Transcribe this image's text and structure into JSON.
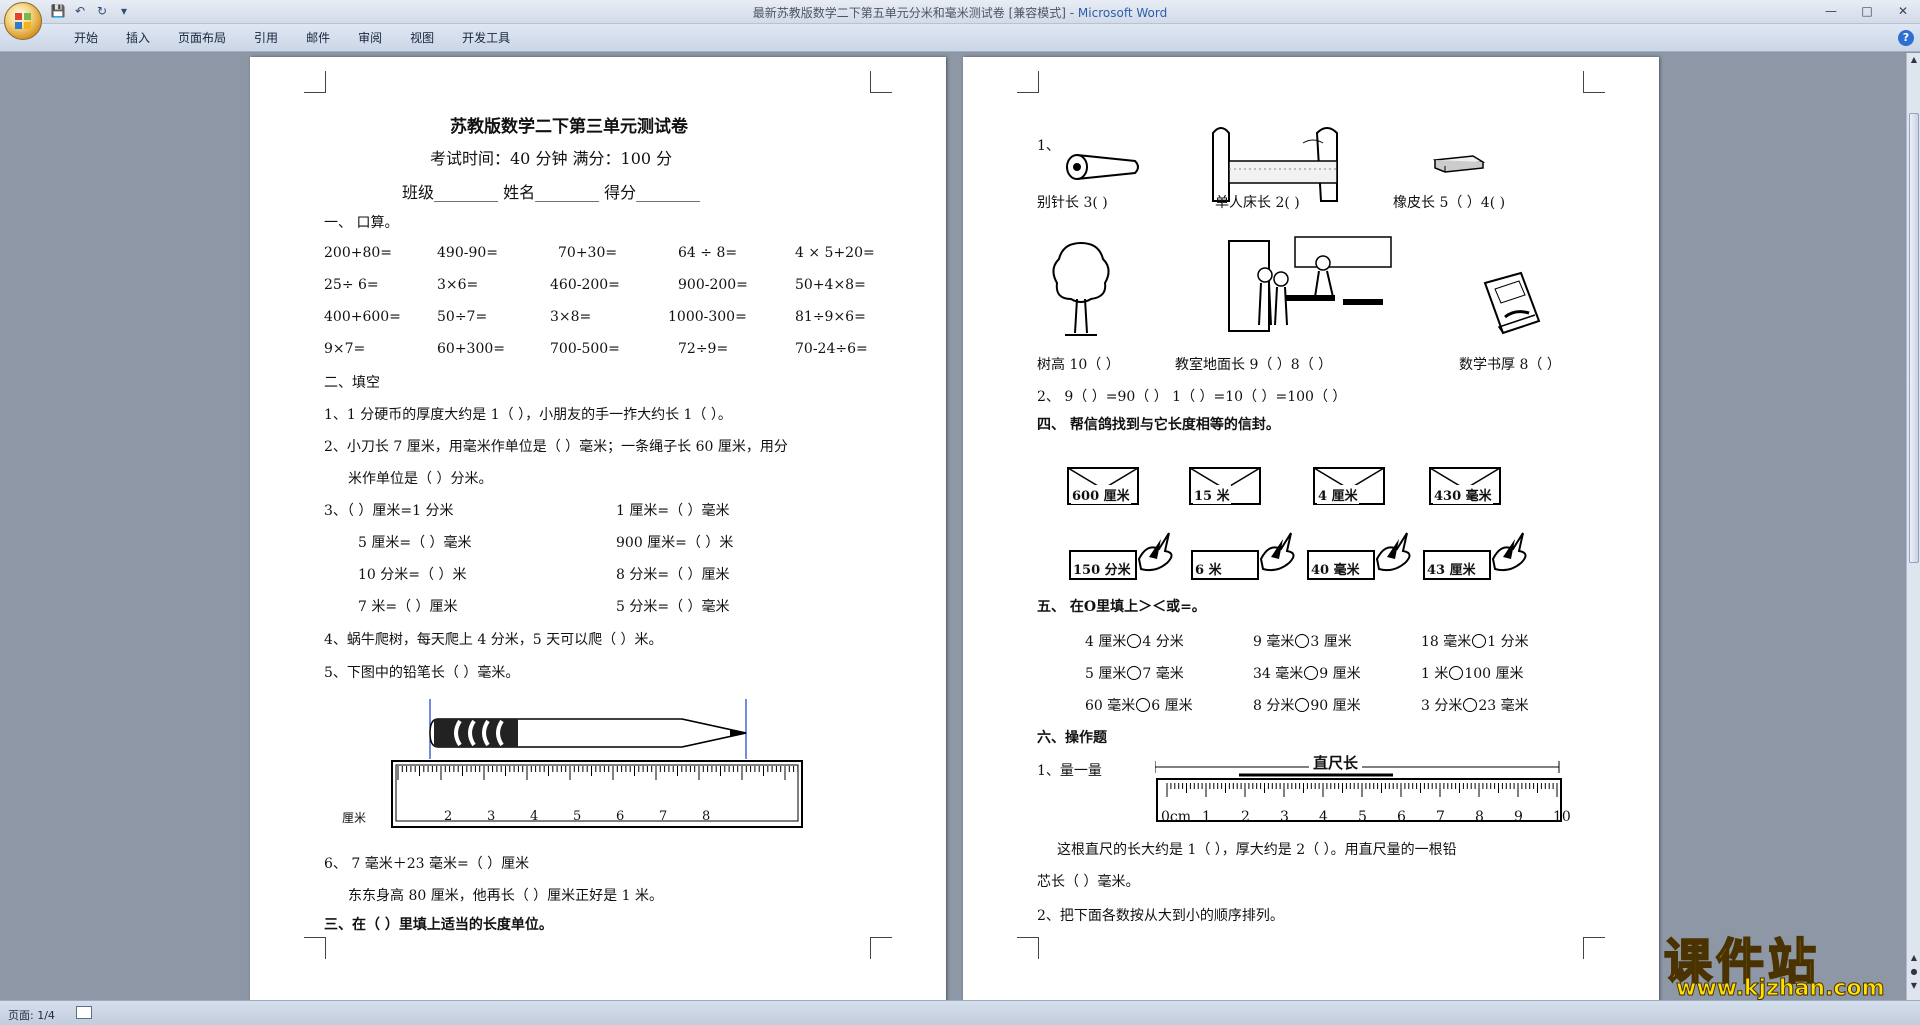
{
  "window": {
    "title": "最新苏教版数学二下第五单元分米和毫米测试卷 [兼容模式] - ",
    "app_name": "Microsoft Word"
  },
  "ribbon": {
    "tabs": [
      "开始",
      "插入",
      "页面布局",
      "引用",
      "邮件",
      "审阅",
      "视图",
      "开发工具"
    ]
  },
  "status": {
    "page": "页面: 1/4"
  },
  "watermark": {
    "cn": "课件站",
    "url": "www.kjzhan.com"
  },
  "left_page": {
    "title": "苏教版数学二下第三单元测试卷",
    "time": "考试时间：40 分钟      满分：100 分",
    "info": "班级________    姓名________    得分________",
    "s1_head": "一、    口算。",
    "calc_rows": [
      [
        "200+80=",
        "490-90=",
        "70+30=",
        "64 ÷ 8=",
        "4 × 5+20="
      ],
      [
        "25÷ 6=",
        "3×6=",
        "460-200=",
        "900-200=",
        "50+4×8="
      ],
      [
        "400+600=",
        "50÷7=",
        "3×8=",
        "1000-300=",
        "81÷9×6="
      ],
      [
        "9×7=",
        "60+300=",
        "700-500=",
        "72÷9=",
        "70-24÷6="
      ]
    ],
    "s2_head": "二、填空",
    "q1": "1、1 分硬币的厚度大约是 1（            ），小朋友的手一拃大约长 1（          ）。",
    "q2a": "2、小刀长 7 厘米，用毫米作单位是（        ）毫米；一条绳子长 60 厘米，用分",
    "q2b": "米作单位是（      ）分米。",
    "q3": [
      [
        "3、（        ）厘米=1 分米",
        "1 厘米=（        ）毫米"
      ],
      [
        "5 厘米=（        ）毫米",
        "900 厘米=（      ）米"
      ],
      [
        "10 分米=（        ）米",
        "8 分米=（      ）厘米"
      ],
      [
        "7 米=（        ）厘米",
        "5 分米=（        ）毫米"
      ]
    ],
    "q4": "4、蜗牛爬树，每天爬上 4 分米，5 天可以爬（      ）米。",
    "q5": "5、下图中的铅笔长（          ）毫米。",
    "ruler_unit": "厘米",
    "ruler_nums": [
      "2",
      "3",
      "4",
      "5",
      "6",
      "7",
      "8"
    ],
    "q6a": "6、  7 毫米＋23 毫米=（        ）厘米",
    "q6b": "东东身高 80 厘米，他再长（        ）厘米正好是 1 米。",
    "s3_head": "三、在（  ）里填上适当的长度单位。"
  },
  "right_page": {
    "item1": "1、",
    "row1": [
      "别针长 3(          )",
      "单人床长 2(          )",
      "橡皮长 5（        ）4(        )"
    ],
    "row2": [
      "树高 10（        ）",
      "教室地面长 9（        ）8（          ）",
      "数学书厚 8（      ）"
    ],
    "item2": "2、    9（        ）=90（          ）              1（    ）=10（          ）=100（        ）",
    "s4_head": "四、    帮信鸽找到与它长度相等的信封。",
    "envelopes": [
      "600 厘米",
      "15 米",
      "4 厘米",
      "430 毫米"
    ],
    "pigeons": [
      "150 分米",
      "6 米",
      "40 毫米",
      "43 厘米"
    ],
    "s5_head": "五、    在O里填上＞＜或=。",
    "compare": [
      [
        "4 厘米",
        "4 分米",
        "9 毫米",
        "3 厘米",
        "18 毫米",
        "1 分米"
      ],
      [
        "5 厘米",
        "7 毫米",
        "34 毫米",
        "9 厘米",
        "1 米",
        "100 厘米"
      ],
      [
        "60 毫米",
        "6 厘米",
        "8 分米",
        "90 厘米",
        "3 分米",
        "23 毫米"
      ]
    ],
    "s6_head": "六、操作题",
    "op1": "1、量一量",
    "ruler_label": "直尺长",
    "ruler2_nums": [
      "0cm",
      "1",
      "2",
      "3",
      "4",
      "5",
      "6",
      "7",
      "8",
      "9",
      "10"
    ],
    "op_text_a": "这根直尺的长大约是 1（        ），厚大约是 2（          ）。用直尺量的一根铅",
    "op_text_b": "芯长（        ）毫米。",
    "op2": "2、把下面各数按从大到小的顺序排列。"
  }
}
